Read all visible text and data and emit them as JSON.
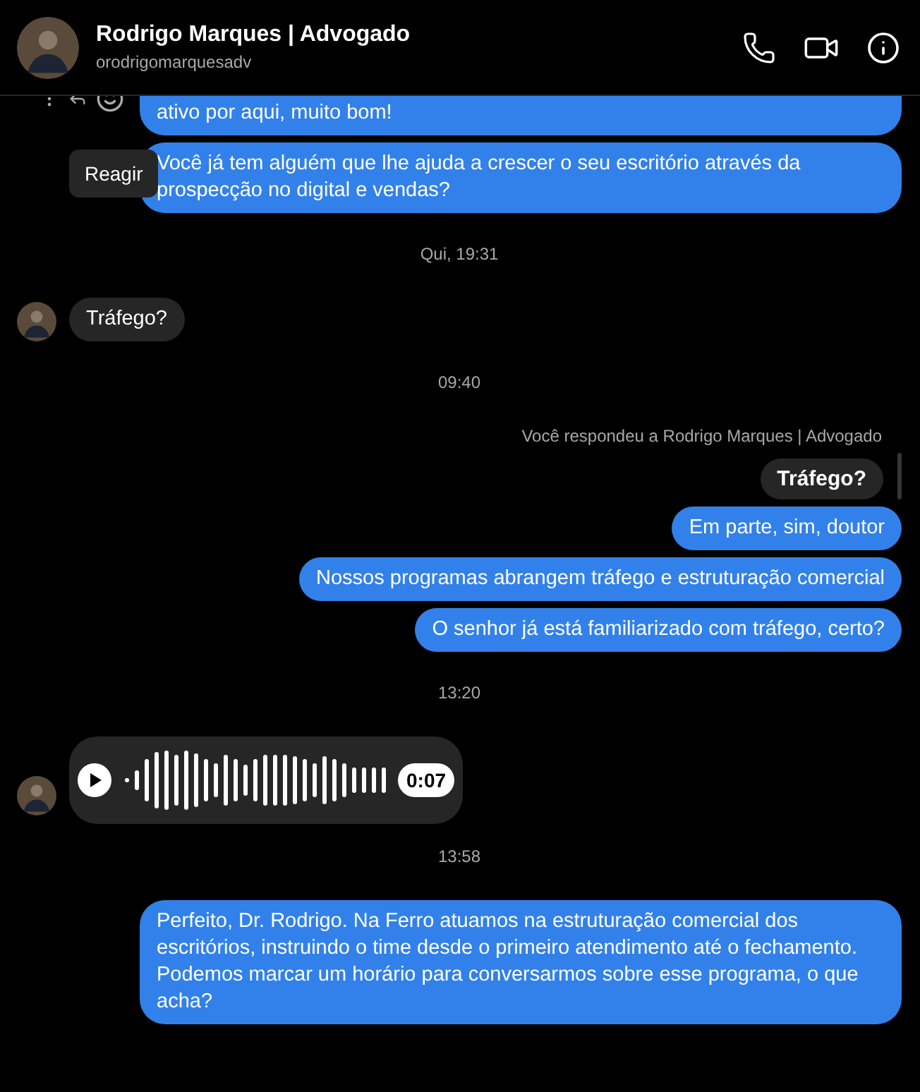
{
  "header": {
    "name": "Rodrigo Marques | Advogado",
    "username": "orodrigomarquesadv"
  },
  "tooltip": "Reagir",
  "messages": [
    {
      "kind": "outgoing",
      "text": "ativo por aqui, muito bom!",
      "cut_top": true,
      "actions": true
    },
    {
      "kind": "outgoing",
      "text": "Você já tem alguém que lhe ajuda a crescer o seu escritório através da prospecção no digital e vendas?"
    },
    {
      "kind": "timestamp",
      "text": "Qui, 19:31"
    },
    {
      "kind": "incoming",
      "text": "Tráfego?"
    },
    {
      "kind": "timestamp",
      "text": "09:40"
    },
    {
      "kind": "reply_context",
      "text": "Você respondeu a Rodrigo Marques | Advogado"
    },
    {
      "kind": "quoted",
      "text": "Tráfego?"
    },
    {
      "kind": "outgoing",
      "text": "Em parte, sim, doutor"
    },
    {
      "kind": "outgoing",
      "text": "Nossos programas abrangem tráfego e estruturação comercial"
    },
    {
      "kind": "outgoing",
      "text": "O senhor já está familiarizado com tráfego, certo?"
    },
    {
      "kind": "timestamp",
      "text": "13:20"
    },
    {
      "kind": "voice",
      "duration": "0:07"
    },
    {
      "kind": "timestamp",
      "text": "13:58"
    },
    {
      "kind": "outgoing",
      "text": "Perfeito, Dr. Rodrigo. Na Ferro atuamos na estruturação comercial dos escritórios, instruindo o time desde o primeiro atendimento até o fechamento. Podemos marcar um horário para conversarmos sobre esse programa, o que acha?"
    }
  ]
}
